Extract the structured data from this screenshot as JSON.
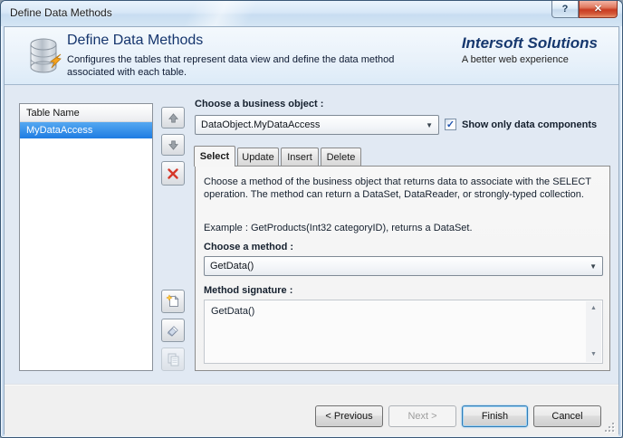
{
  "window": {
    "title": "Define Data Methods"
  },
  "icons": {
    "help_glyph": "?",
    "close_glyph": "✕",
    "dropdown_arrow_glyph": "▼",
    "scroll_up_glyph": "▲",
    "scroll_down_glyph": "▼",
    "checkbox_check_glyph": "✓"
  },
  "header": {
    "title": "Define Data Methods",
    "subtitle": "Configures the tables that represent data view and define the data method associated with each table.",
    "brand": "Intersoft Solutions",
    "brand_tagline": "A better web experience"
  },
  "table_panel": {
    "column_header": "Table Name",
    "rows": [
      "MyDataAccess"
    ],
    "selected_index": 0
  },
  "business_object": {
    "label": "Choose a business object :",
    "value": "DataObject.MyDataAccess",
    "show_only_label": "Show only data components",
    "show_only_checked": true
  },
  "tabs": {
    "items": [
      {
        "label": "Select",
        "active": true
      },
      {
        "label": "Update",
        "active": false
      },
      {
        "label": "Insert",
        "active": false
      },
      {
        "label": "Delete",
        "active": false
      }
    ]
  },
  "select_panel": {
    "description": "Choose a method of the business object that returns data to associate with the SELECT operation. The method can return a DataSet, DataReader, or strongly-typed collection.",
    "example": "Example : GetProducts(Int32 categoryID), returns a DataSet.",
    "method_label": "Choose a method :",
    "method_value": "GetData()",
    "signature_label": "Method signature :",
    "signature_value": "GetData()"
  },
  "footer": {
    "previous_label": "< Previous",
    "next_label": "Next >",
    "next_enabled": false,
    "finish_label": "Finish",
    "cancel_label": "Cancel"
  },
  "colors": {
    "selection_blue": "#2f87e5",
    "brand_navy": "#16386e",
    "close_red": "#c83c22",
    "delete_x_red": "#d5382a"
  }
}
